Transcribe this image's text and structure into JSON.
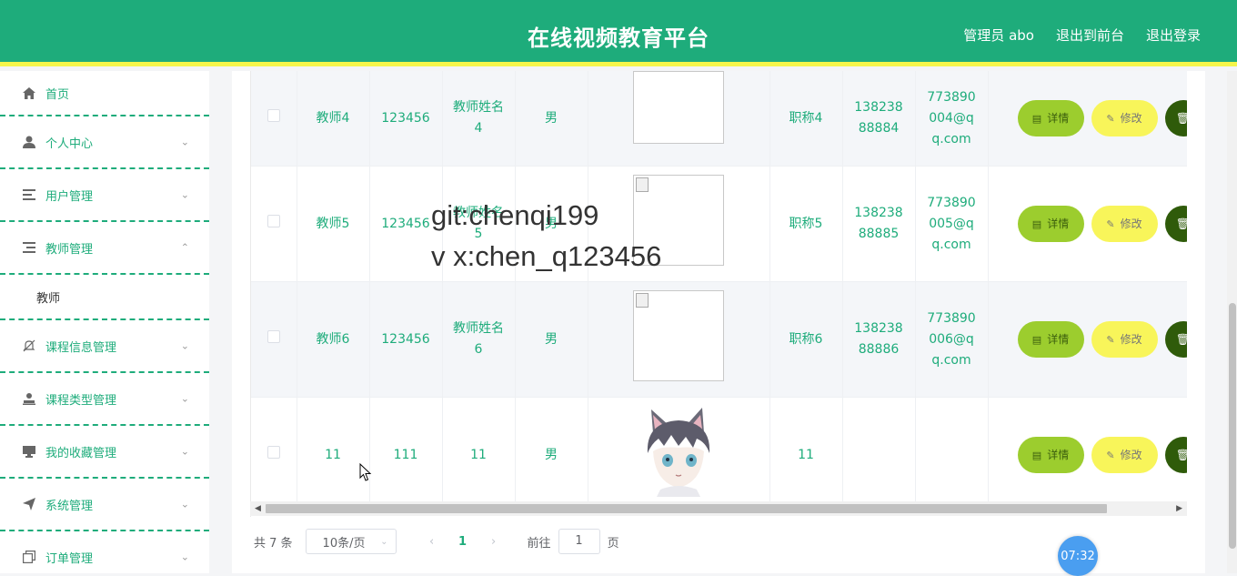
{
  "header": {
    "title": "在线视频教育平台",
    "nav": [
      "管理员 abo",
      "退出到前台",
      "退出登录"
    ]
  },
  "sidebar": {
    "items": [
      {
        "label": "首页",
        "icon": "home-icon"
      },
      {
        "label": "个人中心",
        "icon": "user-icon"
      },
      {
        "label": "用户管理",
        "icon": "list-icon"
      },
      {
        "label": "教师管理",
        "icon": "list-icon"
      },
      {
        "label": "课程信息管理",
        "icon": "bell-off-icon"
      },
      {
        "label": "课程类型管理",
        "icon": "user-stamp-icon"
      },
      {
        "label": "我的收藏管理",
        "icon": "monitor-icon"
      },
      {
        "label": "系统管理",
        "icon": "send-icon"
      },
      {
        "label": "订单管理",
        "icon": "copy-icon"
      }
    ],
    "submenu_teacher": "教师"
  },
  "table": {
    "rows": [
      {
        "account": "教师4",
        "password": "123456",
        "name": "教师姓名4",
        "gender": "男",
        "title": "职称4",
        "phone": "13823888884",
        "email": "773890004@qq.com"
      },
      {
        "account": "教师5",
        "password": "123456",
        "name": "教师姓名5",
        "gender": "男",
        "title": "职称5",
        "phone": "13823888885",
        "email": "773890005@qq.com"
      },
      {
        "account": "教师6",
        "password": "123456",
        "name": "教师姓名6",
        "gender": "男",
        "title": "职称6",
        "phone": "13823888886",
        "email": "773890006@qq.com"
      },
      {
        "account": "11",
        "password": "111",
        "name": "11",
        "gender": "男",
        "title": "11",
        "phone": "",
        "email": ""
      }
    ],
    "btn_detail": "详情",
    "btn_edit": "修改"
  },
  "pager": {
    "total": "共 7 条",
    "page_size": "10条/页",
    "current_page": "1",
    "goto_prefix": "前往",
    "goto_value": "1",
    "goto_suffix": "页"
  },
  "watermark": {
    "line1": "git:chenqi199",
    "line2": "v x:chen_q123456"
  },
  "clock": "07:32",
  "colors": {
    "brand": "#1eac7b",
    "header_stripe": "#f5f64a",
    "btn_detail": "#9ccd2e",
    "btn_edit": "#f8f55a",
    "btn_delete": "#2f5b0a"
  }
}
